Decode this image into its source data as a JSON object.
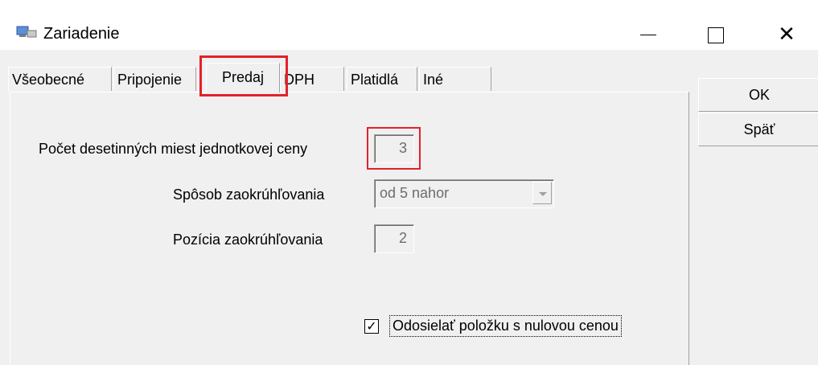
{
  "window": {
    "title": "Zariadenie",
    "icon": "computer-icon",
    "minimize_glyph": "—",
    "close_glyph": "✕"
  },
  "tabs": [
    {
      "label": "Všeobecné",
      "active": false
    },
    {
      "label": "Pripojenie",
      "active": false
    },
    {
      "label": "Predaj",
      "active": true
    },
    {
      "label": "DPH",
      "active": false
    },
    {
      "label": "Platidlá",
      "active": false
    },
    {
      "label": "Iné",
      "active": false
    }
  ],
  "form": {
    "decimal_places_label": "Počet desetinných miest jednotkovej ceny",
    "decimal_places_value": "3",
    "rounding_method_label": "Spôsob zaokrúhľovania",
    "rounding_method_value": "od 5 nahor",
    "rounding_position_label": "Pozícia zaokrúhľovania",
    "rounding_position_value": "2",
    "send_zero_price_label": "Odosielať položku s nulovou cenou",
    "send_zero_price_checked": true
  },
  "buttons": {
    "ok": "OK",
    "back": "Späť"
  },
  "colors": {
    "highlight": "#e3212b",
    "background": "#f0f0f0"
  }
}
